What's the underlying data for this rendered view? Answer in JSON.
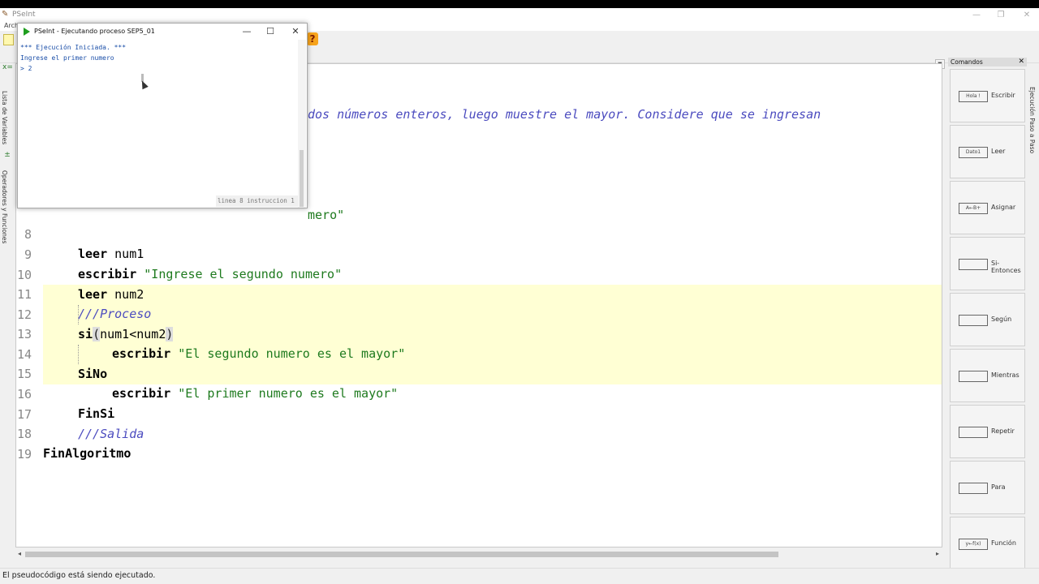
{
  "window": {
    "title": "PSeInt",
    "menu_first": "Arch"
  },
  "toolbar": {
    "help_label": "?"
  },
  "left_tabs": {
    "variables": "Lista de Variables",
    "operators": "Operadores y Funciones"
  },
  "right_tab": "Ejecución Paso a Paso",
  "commands_panel": {
    "title": "Comandos",
    "items": [
      {
        "label": "Escribir",
        "shape": "Hola !"
      },
      {
        "label": "Leer",
        "shape": "Dato1"
      },
      {
        "label": "Asignar",
        "shape": "A←B+"
      },
      {
        "label": "Si-Entonces",
        "shape": ""
      },
      {
        "label": "Según",
        "shape": ""
      },
      {
        "label": "Mientras",
        "shape": ""
      },
      {
        "label": "Repetir",
        "shape": ""
      },
      {
        "label": "Para",
        "shape": ""
      },
      {
        "label": "Función",
        "shape": "y←f(x)"
      }
    ]
  },
  "editor": {
    "visible_header_fragment": "dos números enteros, luego muestre el mayor. Considere que se ingresan",
    "partial_line_7_fragment": "mero\"",
    "lines": [
      {
        "n": "8",
        "kw": "leer",
        "rest": " num1"
      },
      {
        "n": "9",
        "kw": "escribir",
        "str": " \"Ingrese el segundo numero\""
      },
      {
        "n": "10",
        "kw": "leer",
        "rest": " num2"
      },
      {
        "n": "11",
        "comment": "///Proceso"
      },
      {
        "n": "12",
        "kw": "si",
        "rest": "num1<num2"
      },
      {
        "n": "13",
        "kw": "escribir",
        "str": " \"El segundo numero es el mayor\""
      },
      {
        "n": "14",
        "kw": "SiNo"
      },
      {
        "n": "15",
        "kw": "escribir",
        "str": " \"El primer numero es el mayor\""
      },
      {
        "n": "16",
        "kw": "FinSi"
      },
      {
        "n": "17",
        "comment": "///Salida"
      },
      {
        "n": "18",
        "kw": "FinAlgoritmo"
      },
      {
        "n": "19"
      }
    ]
  },
  "exec_window": {
    "title": "PSeInt - Ejecutando proceso SEP5_01",
    "console": [
      "*** Ejecución Iniciada. ***",
      "Ingrese el primer numero",
      "> 2"
    ],
    "status": "linea 8 instruccion 1"
  },
  "statusbar": {
    "text": "El pseudocódigo está siendo ejecutado."
  },
  "colors": {
    "keyword": "#000000",
    "string": "#1e7a1e",
    "comment": "#4b4bbf",
    "highlight": "#ffffd4",
    "console_text": "#1a4ea8"
  }
}
